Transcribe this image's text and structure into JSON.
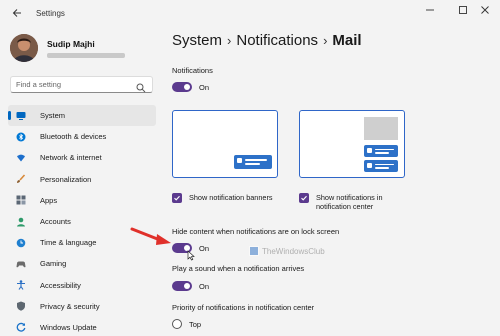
{
  "window": {
    "title": "Settings",
    "back_icon": "back-arrow-icon",
    "controls": [
      "minimize-icon",
      "maximize-icon",
      "close-icon"
    ]
  },
  "profile": {
    "name": "Sudip Majhi"
  },
  "search": {
    "placeholder": "Find a setting",
    "icon": "search-icon"
  },
  "sidebar": {
    "items": [
      {
        "label": "System",
        "icon": "system-icon",
        "active": true,
        "color": "#0067c0"
      },
      {
        "label": "Bluetooth & devices",
        "icon": "bluetooth-icon",
        "color": "#0078d4"
      },
      {
        "label": "Network & internet",
        "icon": "wifi-icon",
        "color": "#1d6fcc"
      },
      {
        "label": "Personalization",
        "icon": "brush-icon",
        "color": "#d88a3a"
      },
      {
        "label": "Apps",
        "icon": "apps-icon",
        "color": "#5b6775"
      },
      {
        "label": "Accounts",
        "icon": "account-icon",
        "color": "#2e9a6a"
      },
      {
        "label": "Time & language",
        "icon": "globe-clock-icon",
        "color": "#1f7fcf"
      },
      {
        "label": "Gaming",
        "icon": "gamepad-icon",
        "color": "#6b6b6b"
      },
      {
        "label": "Accessibility",
        "icon": "accessibility-icon",
        "color": "#2a6fc4"
      },
      {
        "label": "Privacy & security",
        "icon": "shield-icon",
        "color": "#5d6770"
      },
      {
        "label": "Windows Update",
        "icon": "update-icon",
        "color": "#1a73c9"
      }
    ]
  },
  "breadcrumb": {
    "part1": "System",
    "part2": "Notifications",
    "current": "Mail",
    "separator": "›"
  },
  "main": {
    "notifications_label": "Notifications",
    "notifications_toggle": "On",
    "banner_check_label": "Show notification banners",
    "center_check_label_1": "Show notifications in",
    "center_check_label_2": "notification center",
    "hide_content_label": "Hide content when notifications are on lock screen",
    "hide_content_toggle": "On",
    "sound_label": "Play a sound when a notification arrives",
    "sound_toggle": "On",
    "priority_label": "Priority of notifications in notification center",
    "priority_option": "Top"
  },
  "watermark": {
    "text": "TheWindowsClub"
  },
  "colors": {
    "accent": "#5b3a8e",
    "blue": "#2d71c8",
    "arrow": "#e0302a"
  }
}
